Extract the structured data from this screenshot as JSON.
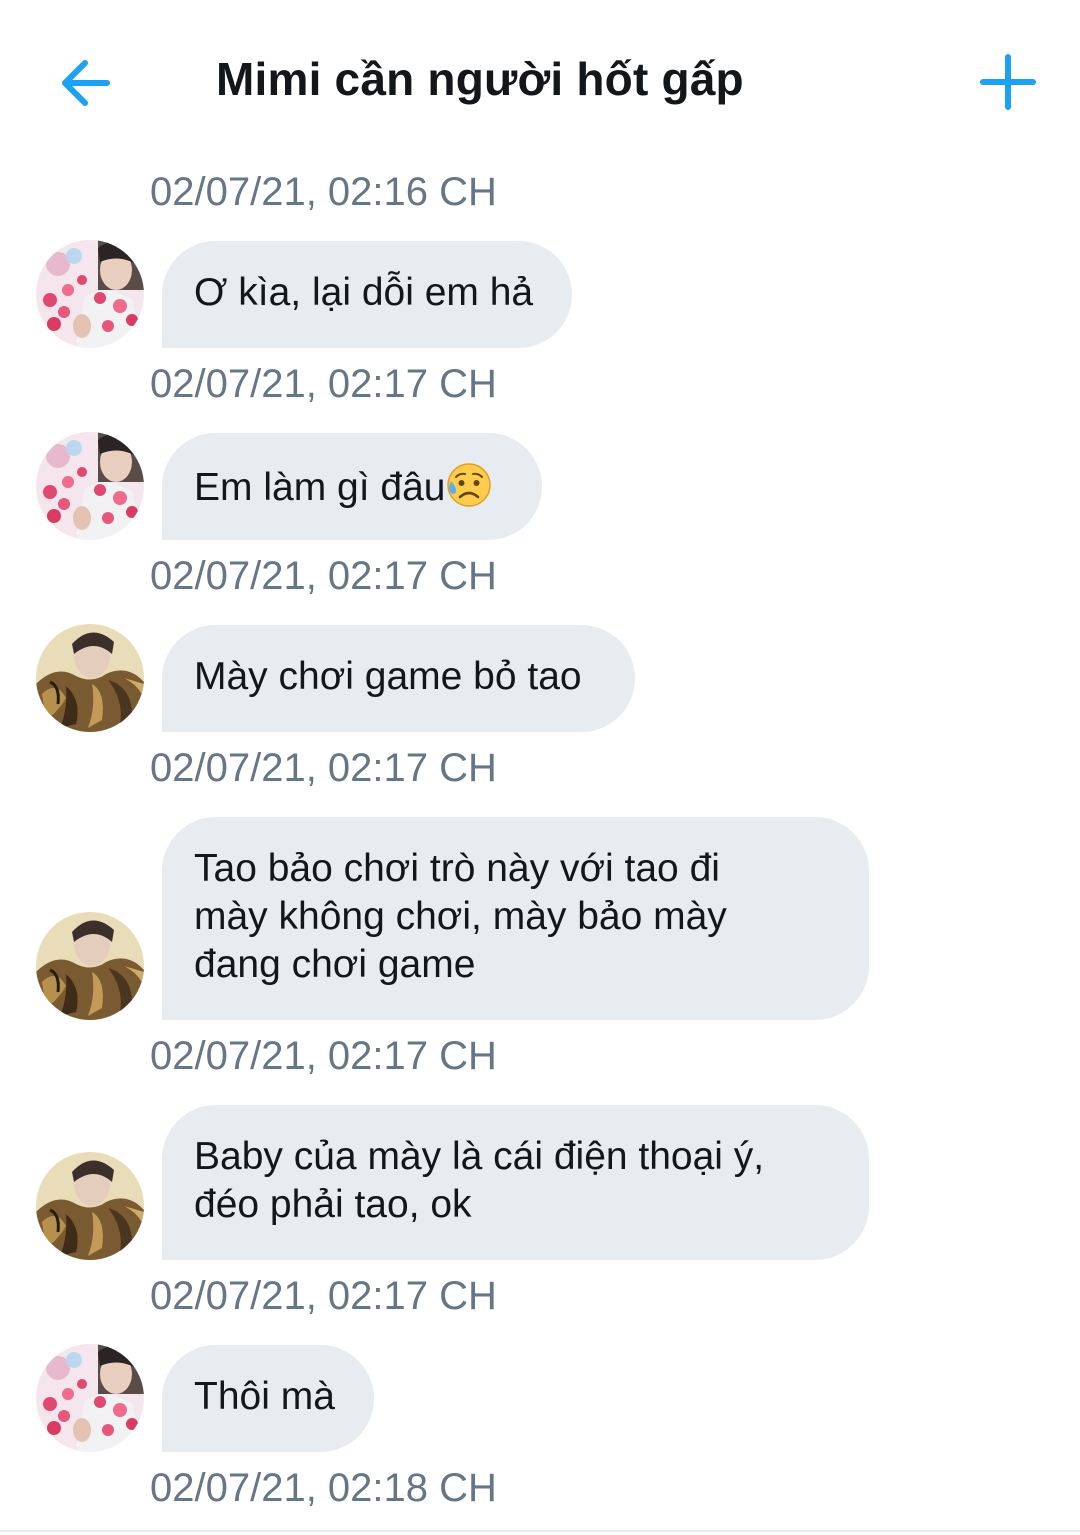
{
  "header": {
    "back_icon": "arrow-left-icon",
    "title": "Mimi cần người hốt gấp",
    "add_icon": "plus-icon",
    "accent_color": "#1da1f2"
  },
  "messages": [
    {
      "timestamp": "02/07/21, 02:16 CH",
      "avatar": "avatar-pink-hearts",
      "lines": [
        "Ơ kìa, lại dỗi em hả"
      ]
    },
    {
      "timestamp": "02/07/21, 02:17 CH",
      "avatar": "avatar-pink-hearts",
      "lines": [
        "Em làm gì đâu"
      ],
      "emoji": "sad-but-relieved-face-icon"
    },
    {
      "timestamp": "02/07/21, 02:17 CH",
      "avatar": "avatar-fur-coat",
      "lines": [
        "Mày chơi game bỏ tao"
      ]
    },
    {
      "timestamp": "02/07/21, 02:17 CH",
      "avatar": "avatar-fur-coat",
      "lines": [
        "Tao bảo chơi trò này với tao đi",
        "mày không chơi, mày bảo mày",
        "đang chơi game"
      ]
    },
    {
      "timestamp": "02/07/21, 02:17 CH",
      "avatar": "avatar-fur-coat",
      "lines": [
        "Baby của mày là cái điện thoại ý,",
        "đéo phải tao, ok"
      ]
    },
    {
      "timestamp": "02/07/21, 02:17 CH",
      "avatar": "avatar-pink-hearts",
      "lines": [
        "Thôi mà"
      ]
    }
  ],
  "last_timestamp": "02/07/21, 02:18 CH",
  "colors": {
    "bubble_bg": "#e6ecf0",
    "timestamp_text": "#657786",
    "message_text": "#14171a"
  }
}
